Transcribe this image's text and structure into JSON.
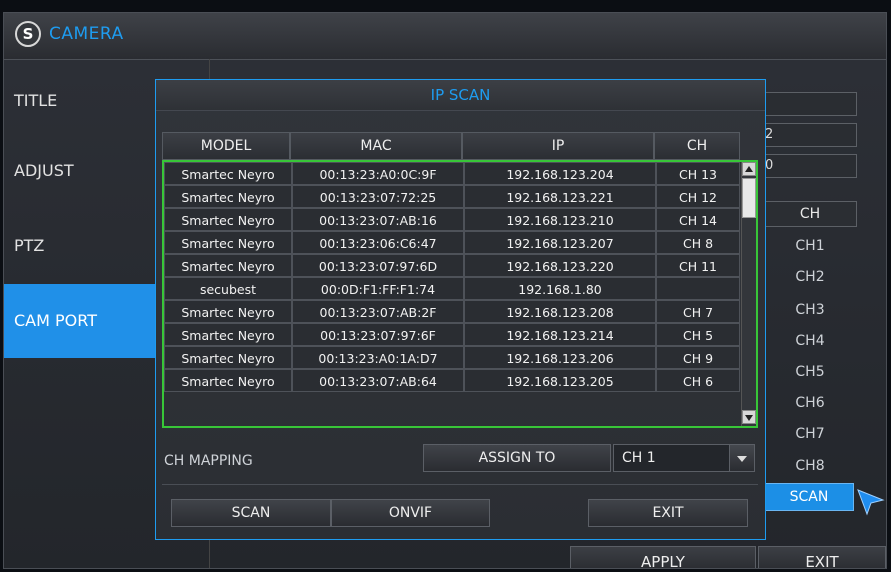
{
  "app": {
    "title": "CAMERA"
  },
  "sidebar": {
    "items": [
      {
        "label": "TITLE"
      },
      {
        "label": "ADJUST"
      },
      {
        "label": "PTZ"
      },
      {
        "label": "CAM PORT"
      }
    ]
  },
  "background_panel": {
    "field_values": [
      "",
      "2",
      "0"
    ],
    "ch_header": "CH",
    "channels": [
      "CH1",
      "CH2",
      "CH3",
      "CH4",
      "CH5",
      "CH6",
      "CH7",
      "CH8"
    ],
    "scan_button": "SCAN",
    "apply_button": "APPLY",
    "exit_button": "EXIT"
  },
  "dialog": {
    "title": "IP SCAN",
    "columns": [
      "MODEL",
      "MAC",
      "IP",
      "CH"
    ],
    "rows": [
      [
        "Smartec Neyro",
        "00:13:23:A0:0C:9F",
        "192.168.123.204",
        "CH 13"
      ],
      [
        "Smartec Neyro",
        "00:13:23:07:72:25",
        "192.168.123.221",
        "CH 12"
      ],
      [
        "Smartec Neyro",
        "00:13:23:07:AB:16",
        "192.168.123.210",
        "CH 14"
      ],
      [
        "Smartec Neyro",
        "00:13:23:06:C6:47",
        "192.168.123.207",
        "CH 8"
      ],
      [
        "Smartec Neyro",
        "00:13:23:07:97:6D",
        "192.168.123.220",
        "CH 11"
      ],
      [
        "secubest",
        "00:0D:F1:FF:F1:74",
        "192.168.1.80",
        ""
      ],
      [
        "Smartec Neyro",
        "00:13:23:07:AB:2F",
        "192.168.123.208",
        "CH 7"
      ],
      [
        "Smartec Neyro",
        "00:13:23:07:97:6F",
        "192.168.123.214",
        "CH 5"
      ],
      [
        "Smartec Neyro",
        "00:13:23:A0:1A:D7",
        "192.168.123.206",
        "CH 9"
      ],
      [
        "Smartec Neyro",
        "00:13:23:07:AB:64",
        "192.168.123.205",
        "CH 6"
      ]
    ],
    "ch_mapping_label": "CH MAPPING",
    "assign_button": "ASSIGN TO",
    "assign_select_value": "CH 1",
    "scan_button": "SCAN",
    "onvif_button": "ONVIF",
    "exit_button": "EXIT"
  },
  "colors": {
    "accent": "#1e9cf0",
    "selection_border": "#38c638",
    "active_sidebar": "#2090e8"
  }
}
